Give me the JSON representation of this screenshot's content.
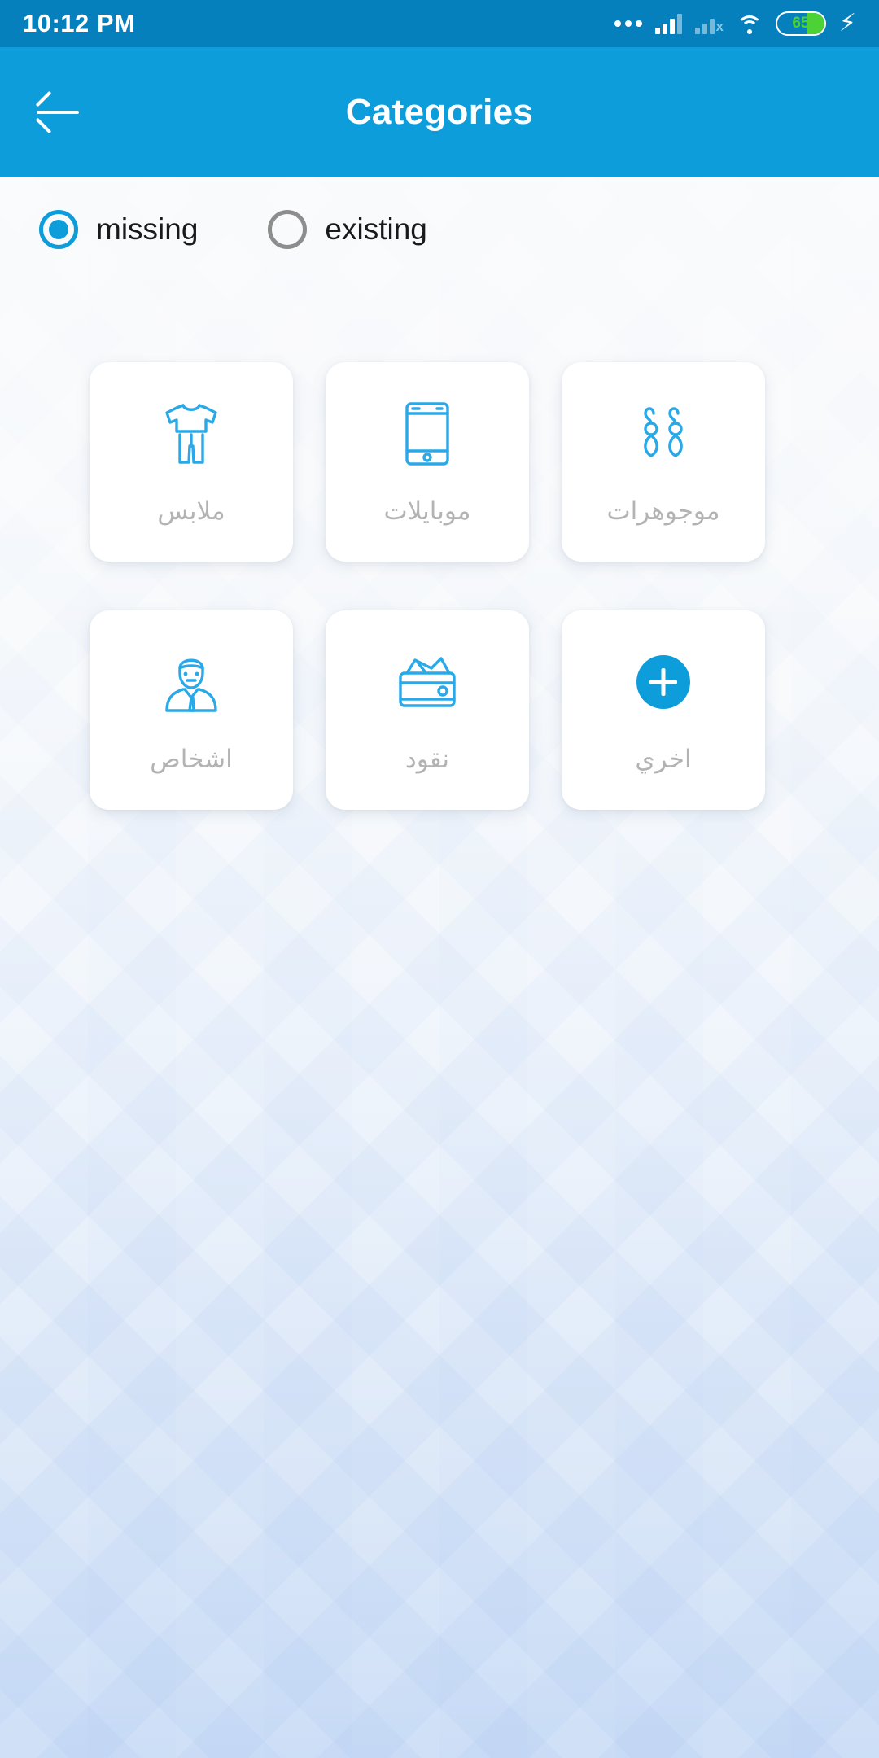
{
  "statusbar": {
    "time": "10:12 PM",
    "icons": [
      "dots-icon",
      "signal-bars-icon",
      "signal-no-service-icon",
      "wifi-icon",
      "battery-icon",
      "charging-bolt-icon"
    ],
    "battery_level": "65",
    "battery_color": "#4cd137",
    "no_service_mark": "x",
    "background_color": "#0580bd"
  },
  "appbar": {
    "title": "Categories",
    "back_icon": "arrow-left-icon",
    "background_color": "#0d9ddb"
  },
  "filter": {
    "options": [
      {
        "label": "missing",
        "selected": true
      },
      {
        "label": "existing",
        "selected": false
      }
    ],
    "accent_color": "#0d9ddb",
    "inactive_color": "#8d8d8d"
  },
  "categories": {
    "label_color": "#b3b3b3",
    "icon_color": "#29a9e8",
    "items": [
      {
        "label": "ملابس",
        "icon": "clothes-icon"
      },
      {
        "label": "موبايلات",
        "icon": "smartphone-icon"
      },
      {
        "label": "موجوهرات",
        "icon": "jewelry-earrings-icon"
      },
      {
        "label": "اشخاص",
        "icon": "person-icon"
      },
      {
        "label": "نقود",
        "icon": "wallet-money-icon"
      },
      {
        "label": "اخري",
        "icon": "plus-circle-icon"
      }
    ]
  }
}
